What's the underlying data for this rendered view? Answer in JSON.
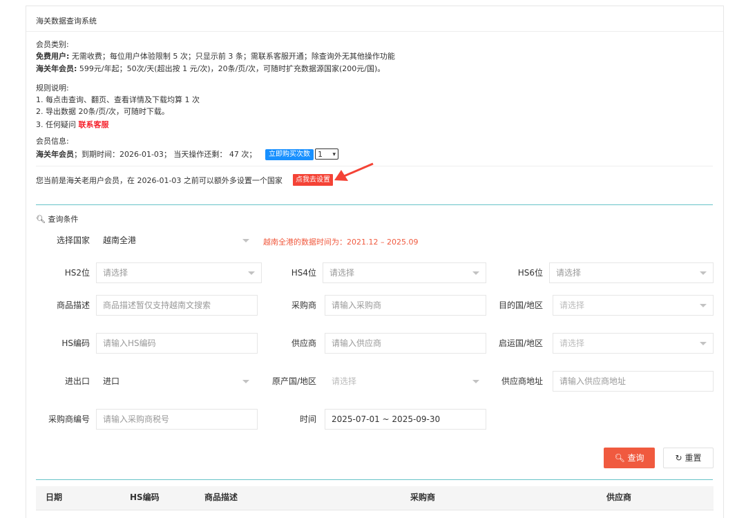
{
  "header": {
    "title": "海关数据查询系统"
  },
  "membership": {
    "heading": "会员类别:",
    "free_label": "免费用户:",
    "free_text": "无需收费；每位用户体验限制 5 次；只显示前 3 条；需联系客服开通；除查询外无其他操作功能",
    "annual_label": "海关年会员:",
    "annual_text": "599元/年起；50次/天(超出按 1 元/次)，20条/页/次，可随时扩充数据源国家(200元/国)。"
  },
  "rules": {
    "heading": "规则说明:",
    "rule1": "1. 每点击查询、翻页、查看详情及下载均算 1 次",
    "rule2": "2. 导出数据 20条/页/次，可随时下载。",
    "rule3_prefix": "3. 任何疑问",
    "rule3_link": "联系客服"
  },
  "member_info": {
    "heading": "会员信息:",
    "type_label": "海关年会员",
    "detail": "；到期时间：2026-01-03；  当天操作还剩：  47 次；",
    "buy_button": "立即购买次数",
    "qty_value": "1"
  },
  "notice": {
    "text": "您当前是海关老用户会员，在 2026-01-03 之前可以额外多设置一个国家",
    "button": "点我去设置",
    "arrow_color": "#f44336"
  },
  "query": {
    "section_title": "查询条件",
    "country_label": "选择国家",
    "country_value": "越南全港",
    "country_note": "越南全港的数据时间为：2021.12 – 2025.09",
    "hs2_label": "HS2位",
    "hs2_placeholder": "请选择",
    "hs4_label": "HS4位",
    "hs4_placeholder": "请选择",
    "hs6_label": "HS6位",
    "hs6_placeholder": "请选择",
    "desc_label": "商品描述",
    "desc_placeholder": "商品描述暂仅支持越南文搜索",
    "buyer_label": "采购商",
    "buyer_placeholder": "请输入采购商",
    "dest_label": "目的国/地区",
    "dest_placeholder": "请选择",
    "hscode_label": "HS编码",
    "hscode_placeholder": "请输入HS编码",
    "supplier_label": "供应商",
    "supplier_placeholder": "请输入供应商",
    "origin_port_label": "启运国/地区",
    "origin_port_placeholder": "请选择",
    "io_label": "进出口",
    "io_value": "进口",
    "origin_label": "原产国/地区",
    "origin_placeholder": "请选择",
    "supplier_addr_label": "供应商地址",
    "supplier_addr_placeholder": "请输入供应商地址",
    "buyer_code_label": "采购商编号",
    "buyer_code_placeholder": "请输入采购商税号",
    "time_label": "时间",
    "time_value": "2025-07-01 ~ 2025-09-30",
    "search_button": "查询",
    "reset_button": "重置"
  },
  "table": {
    "columns": [
      "日期",
      "HS编码",
      "商品描述",
      "采购商",
      "供应商"
    ]
  },
  "colors": {
    "accent_blue": "#1890ff",
    "accent_red": "#f05a3f",
    "divider_teal": "#66c2c7"
  }
}
